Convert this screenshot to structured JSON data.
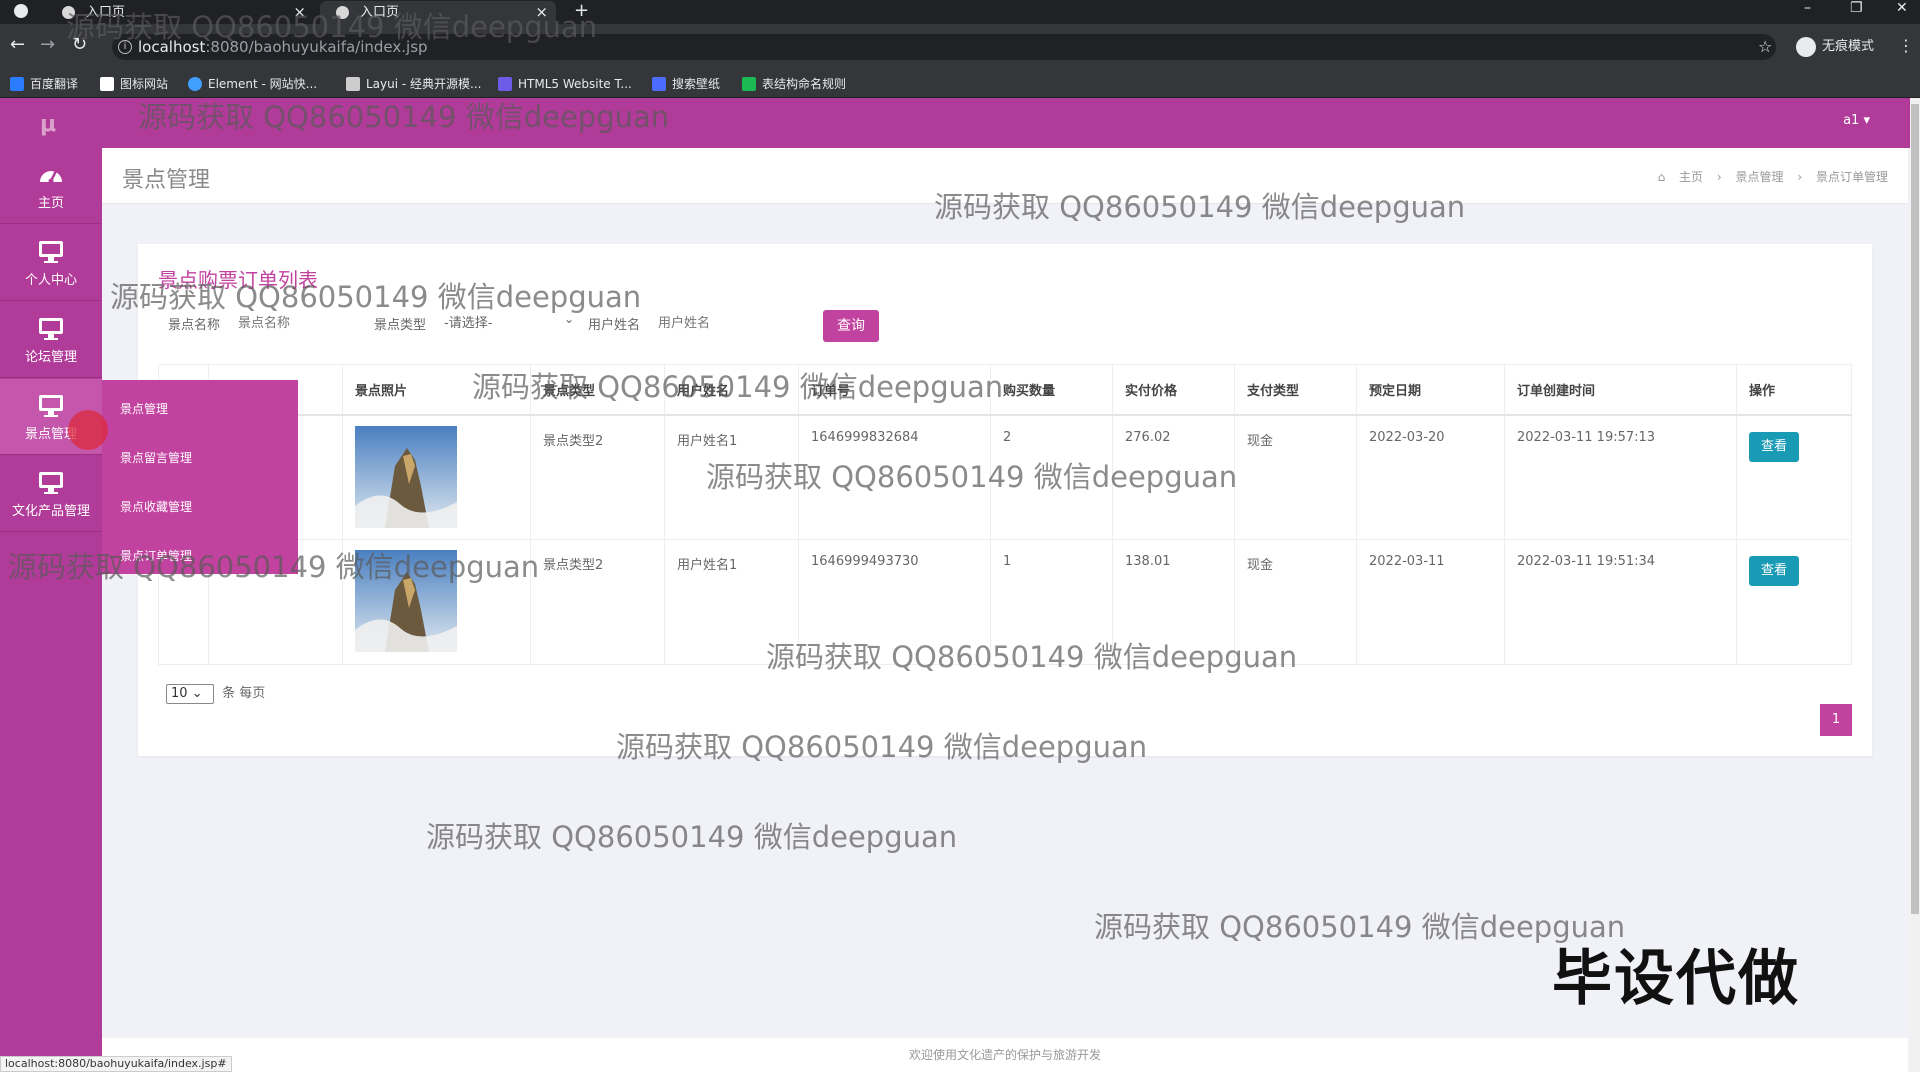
{
  "browser": {
    "tabs": [
      {
        "title": "入口页",
        "close": "×"
      },
      {
        "title": "入口页",
        "close": "×"
      }
    ],
    "new_tab": "+",
    "url_host": "localhost",
    "url_path": ":8080/baohuyukaifa/index.jsp",
    "incognito_label": "无痕模式",
    "bookmarks": [
      {
        "label": "百度翻译",
        "color": "#2b7cff"
      },
      {
        "label": "图标网站",
        "color": "#ffffff"
      },
      {
        "label": "Element - 网站快...",
        "color": "#409eff"
      },
      {
        "label": "Layui - 经典开源模...",
        "color": "#cccccc"
      },
      {
        "label": "HTML5 Website T...",
        "color": "#6c5ce7"
      },
      {
        "label": "搜索壁纸",
        "color": "#4b6cff"
      },
      {
        "label": "表结构命名规则",
        "color": "#1db954"
      }
    ],
    "status_url": "localhost:8080/baohuyukaifa/index.jsp#"
  },
  "header": {
    "user": "a1 ▾",
    "logo": "μ"
  },
  "sidebar": {
    "items": [
      {
        "label": "主页",
        "icon": "dashboard-icon"
      },
      {
        "label": "个人中心",
        "icon": "monitor-icon"
      },
      {
        "label": "论坛管理",
        "icon": "monitor-icon"
      },
      {
        "label": "景点管理",
        "icon": "monitor-icon"
      },
      {
        "label": "文化产品管理",
        "icon": "monitor-icon"
      }
    ],
    "flyout": [
      "景点管理",
      "景点留言管理",
      "景点收藏管理",
      "景点订单管理"
    ]
  },
  "main": {
    "title": "景点管理",
    "breadcrumb": [
      "主页",
      "景点管理",
      "景点订单管理"
    ]
  },
  "card": {
    "title": "景点购票订单列表",
    "filters": {
      "name_label": "景点名称",
      "name_placeholder": "景点名称",
      "type_label": "景点类型",
      "type_value": "-请选择-",
      "user_label": "用户姓名",
      "user_placeholder": "用户姓名",
      "query_button": "查询"
    },
    "columns": [
      "",
      "",
      "景点照片",
      "景点类型",
      "用户姓名",
      "订单号",
      "购买数量",
      "实付价格",
      "支付类型",
      "预定日期",
      "订单创建时间",
      "操作"
    ],
    "rows": [
      {
        "type": "景点类型2",
        "user": "用户姓名1",
        "order_no": "1646999832684",
        "qty": "2",
        "price": "276.02",
        "pay": "现金",
        "date": "2022-03-20",
        "created": "2022-03-11 19:57:13",
        "action": "查看"
      },
      {
        "type": "景点类型2",
        "user": "用户姓名1",
        "order_no": "1646999493730",
        "qty": "1",
        "price": "138.01",
        "pay": "现金",
        "date": "2022-03-11",
        "created": "2022-03-11 19:51:34",
        "action": "查看"
      }
    ],
    "page_size": "10",
    "page_size_suffix": "条 每页",
    "current_page": "1"
  },
  "footer": "欢迎使用文化遗产的保护与旅游开发",
  "watermark": "源码获取 QQ86050149 微信deepguan",
  "stamp": "毕设代做",
  "colors": {
    "brand": "#b13b98",
    "accent": "#c2429f",
    "view_button": "#1a9bb5"
  }
}
